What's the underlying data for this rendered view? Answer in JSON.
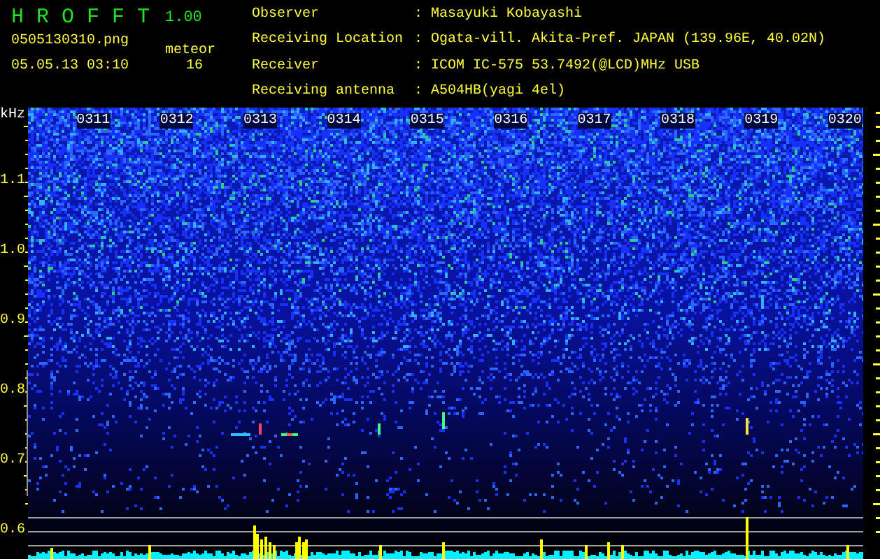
{
  "app": {
    "name": "H R O F F T",
    "version": "1.00"
  },
  "file": {
    "name": "0505130310.png",
    "timestamp": "05.05.13 03:10"
  },
  "meteor": {
    "label": "meteor",
    "count": "16"
  },
  "station_info": [
    {
      "label": "Observer",
      "value": ": Masayuki Kobayashi"
    },
    {
      "label": "Receiving Location",
      "value": ": Ogata-vill. Akita-Pref. JAPAN (139.96E, 40.02N)"
    },
    {
      "label": "Receiver",
      "value": ": ICOM IC-575 53.7492(@LCD)MHz USB"
    },
    {
      "label": "Receiving antenna",
      "value": ": A504HB(yagi 4el)"
    }
  ],
  "frequency_axis": {
    "unit": "kHz",
    "labels": [
      "1.1",
      "1.0",
      "0.9",
      "0.8",
      "0.7",
      "0.6"
    ]
  },
  "time_labels": [
    "0311",
    "0312",
    "0313",
    "0314",
    "0315",
    "0316",
    "0317",
    "0318",
    "0319",
    "0320"
  ]
}
